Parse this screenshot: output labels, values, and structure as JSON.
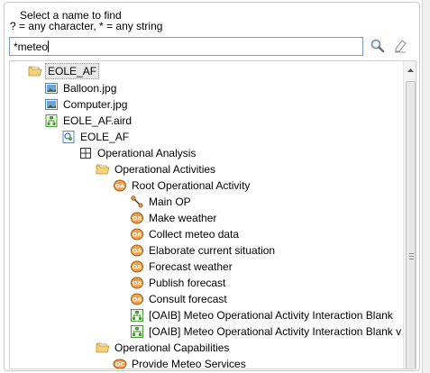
{
  "header": {
    "title": "Select a name to find",
    "hint": "? = any character, * = any string"
  },
  "search": {
    "value": "*meteo"
  },
  "toolbar": {
    "find_icon": "magnifier-icon",
    "clear_icon": "eraser-icon"
  },
  "tree": {
    "items": [
      {
        "label": "EOLE_AF",
        "icon": "folder-open-icon",
        "selected": true
      },
      {
        "label": "Balloon.jpg",
        "icon": "image-file-icon"
      },
      {
        "label": "Computer.jpg",
        "icon": "image-file-icon"
      },
      {
        "label": "EOLE_AF.aird",
        "icon": "aird-file-icon"
      },
      {
        "label": "EOLE_AF",
        "icon": "model-icon"
      },
      {
        "label": "Operational Analysis",
        "icon": "grid-icon"
      },
      {
        "label": "Operational Activities",
        "icon": "folder-open-icon"
      },
      {
        "label": "Root Operational Activity",
        "icon": "oa-icon"
      },
      {
        "label": "Main OP",
        "icon": "process-icon"
      },
      {
        "label": "Make weather",
        "icon": "oa-icon"
      },
      {
        "label": "Collect meteo data",
        "icon": "oa-icon"
      },
      {
        "label": "Elaborate current situation",
        "icon": "oa-icon"
      },
      {
        "label": "Forecast weather",
        "icon": "oa-icon"
      },
      {
        "label": "Publish forecast",
        "icon": "oa-icon"
      },
      {
        "label": "Consult forecast",
        "icon": "oa-icon"
      },
      {
        "label": "[OAIB] Meteo Operational Activity Interaction Blank",
        "icon": "diagram-icon"
      },
      {
        "label": "[OAIB] Meteo Operational Activity Interaction Blank v",
        "icon": "diagram-icon"
      },
      {
        "label": "Operational Capabilities",
        "icon": "folder-open-icon"
      },
      {
        "label": "Provide Meteo Services",
        "icon": "oc-icon"
      }
    ]
  }
}
